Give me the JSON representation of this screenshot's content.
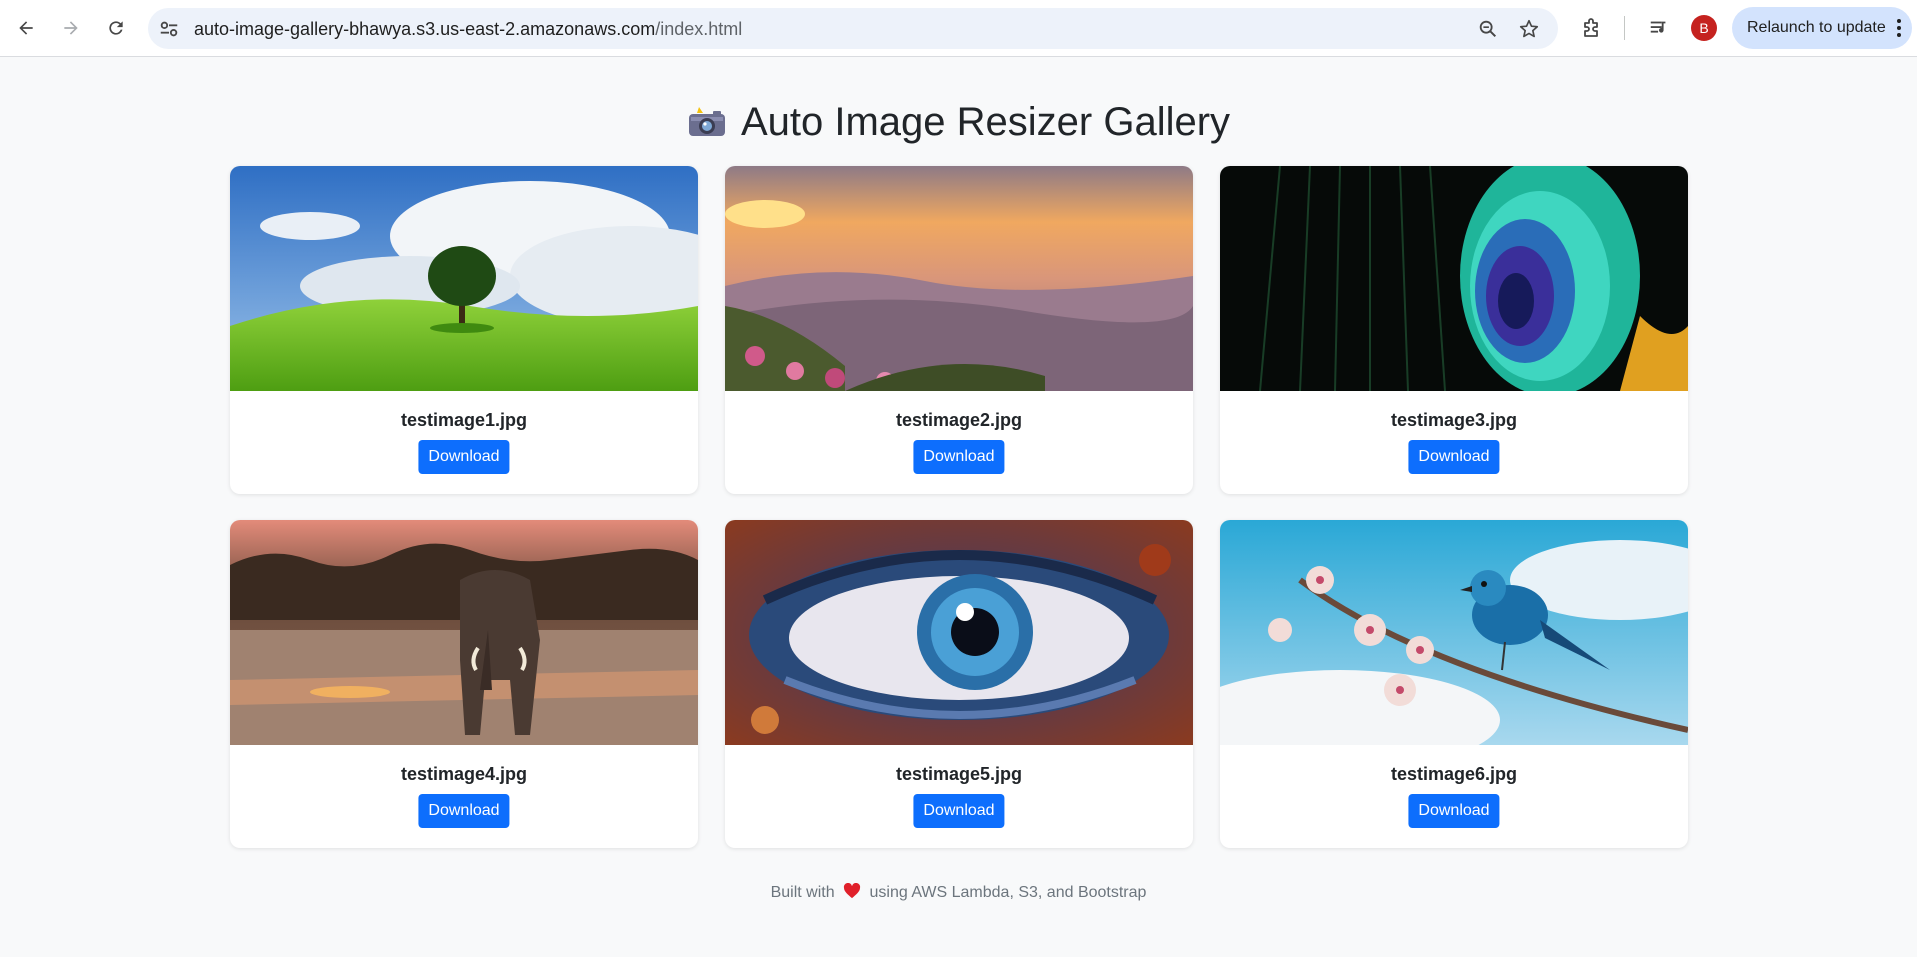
{
  "browser": {
    "url_host": "auto-image-gallery-bhawya.s3.us-east-2.amazonaws.com",
    "url_path": "/index.html",
    "avatar_letter": "B",
    "relaunch_label": "Relaunch to update"
  },
  "page": {
    "title": "Auto Image Resizer Gallery",
    "title_icon": "camera-with-flash-icon"
  },
  "gallery": {
    "download_label": "Download",
    "items": [
      {
        "filename": "testimage1.jpg",
        "scene": "green-hill-tree"
      },
      {
        "filename": "testimage2.jpg",
        "scene": "mountain-sunset-flowers"
      },
      {
        "filename": "testimage3.jpg",
        "scene": "peacock-feather"
      },
      {
        "filename": "testimage4.jpg",
        "scene": "elephant-savanna"
      },
      {
        "filename": "testimage5.jpg",
        "scene": "blue-eye-closeup"
      },
      {
        "filename": "testimage6.jpg",
        "scene": "bluebird-blossom"
      }
    ]
  },
  "footer": {
    "prefix": "Built with",
    "suffix": "using AWS Lambda, S3, and Bootstrap",
    "icon": "heart-icon"
  },
  "colors": {
    "accent": "#0d6efd",
    "background": "#f8f9fa",
    "omnibox": "#edf2fa",
    "relaunch": "#d3e3fd",
    "avatar": "#c5221f"
  }
}
